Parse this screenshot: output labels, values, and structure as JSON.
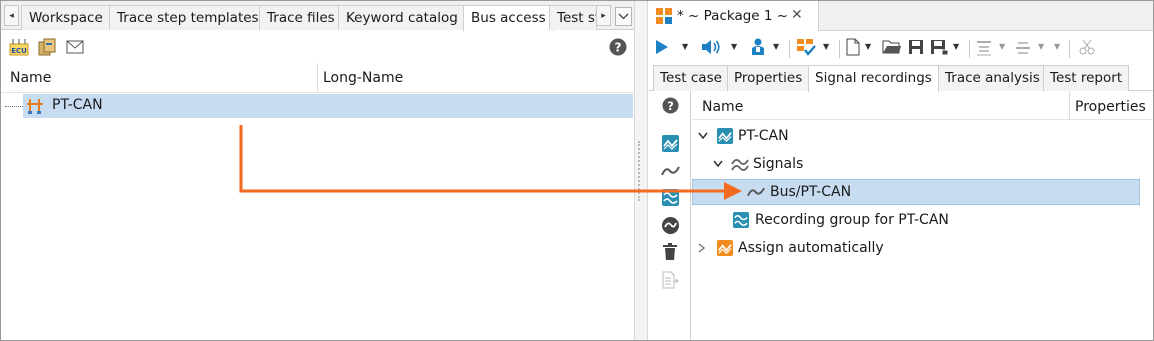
{
  "left_panel": {
    "tabs": [
      "Workspace",
      "Trace step templates",
      "Trace files",
      "Keyword catalog",
      "Bus access",
      "Test st"
    ],
    "active_tab_index": 4,
    "columns": {
      "name": "Name",
      "long_name": "Long-Name"
    },
    "rows": [
      {
        "name": "PT-CAN",
        "long_name": ""
      }
    ],
    "toolbar_icons": [
      "ecu-icon",
      "package-icon",
      "mail-icon"
    ],
    "help_icon": "help-icon"
  },
  "right_panel": {
    "title": "* ~ Package 1 ~",
    "close_glyph": "✕",
    "tabs": [
      "Test case",
      "Properties",
      "Signal recordings",
      "Trace analysis",
      "Test report"
    ],
    "active_tab_index": 2,
    "columns": {
      "name": "Name",
      "properties": "Properties"
    },
    "tree": [
      {
        "label": "PT-CAN",
        "level": 0,
        "expanded": true,
        "icon": "recording-icon"
      },
      {
        "label": "Signals",
        "level": 1,
        "expanded": true,
        "icon": "signals-icon"
      },
      {
        "label": "Bus/PT-CAN",
        "level": 2,
        "selected": true,
        "icon": "signal-icon"
      },
      {
        "label": "Recording group for PT-CAN",
        "level": 1,
        "icon": "recording-group-icon"
      },
      {
        "label": "Assign automatically",
        "level": 0,
        "expanded": false,
        "icon": "assign-auto-icon"
      }
    ]
  },
  "colors": {
    "selection": "#c7dcf1",
    "arrow": "#f26b21",
    "accent_blue": "#1d7fc4",
    "teal": "#2b8fb2",
    "orange": "#f28c1e"
  }
}
